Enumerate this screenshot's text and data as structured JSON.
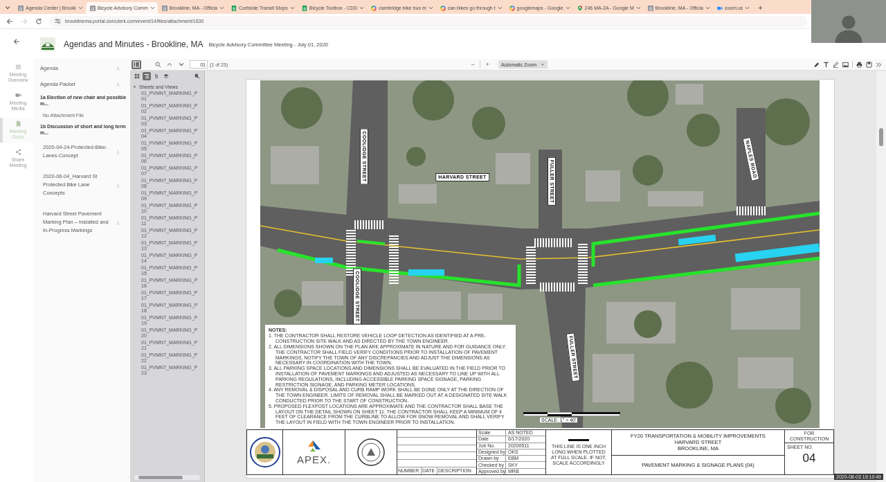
{
  "browser": {
    "tabs": [
      {
        "title": "Agenda Center | Brookl",
        "kind": "site",
        "selected": false
      },
      {
        "title": "Bicycle Advisory Comm",
        "kind": "site",
        "selected": true
      },
      {
        "title": "Brookline, MA - Officia",
        "kind": "site",
        "selected": false
      },
      {
        "title": "Curbside Transit Stops",
        "kind": "sheet",
        "selected": false
      },
      {
        "title": "Bicycle Toolbox - CDD",
        "kind": "sheet",
        "selected": false
      },
      {
        "title": "cambridge bike bus m",
        "kind": "google",
        "selected": false
      },
      {
        "title": "can bikes go through t",
        "kind": "google",
        "selected": false
      },
      {
        "title": "googlemaps - Google",
        "kind": "google",
        "selected": false
      },
      {
        "title": "246 MA-2A - Google M",
        "kind": "maps",
        "selected": false
      },
      {
        "title": "Brookline, MA - Officia",
        "kind": "site",
        "selected": false
      },
      {
        "title": "zoom.us",
        "kind": "zoom",
        "selected": false
      }
    ],
    "new_tab": "+",
    "can_go_forward": false,
    "url": "brooklinema.portal.civicclerk.com/event/14/files/attachment/1630"
  },
  "header": {
    "title": "Agendas and Minutes - Brookline, MA",
    "meeting": "Bicycle Advisory Committee Meeting - July 01, 2020"
  },
  "nav": [
    {
      "label": "Meeting Overview",
      "kind": "list",
      "selected": false
    },
    {
      "label": "Meeting Media",
      "kind": "video",
      "selected": false
    },
    {
      "label": "Meeting Docs",
      "kind": "doc",
      "selected": true
    },
    {
      "label": "Share Meeting",
      "kind": "share",
      "selected": false
    }
  ],
  "agenda": [
    {
      "kind": "file",
      "label": "Agenda"
    },
    {
      "kind": "file",
      "label": "Agenda Packet"
    },
    {
      "kind": "item",
      "label": "1a Election of new chair and possible m..."
    },
    {
      "kind": "empty",
      "label": "No Attachment File"
    },
    {
      "kind": "item",
      "label": "1b Discussion of short and long term m..."
    },
    {
      "kind": "attachment",
      "label": "2020-04-24-Protected-Bike-Lanes-Concept"
    },
    {
      "kind": "attachment",
      "label": "2020-06-04_Harvard St Protected Bike Lane Concepts"
    },
    {
      "kind": "attachment",
      "label": "Harvard Street Pavement Marking Plan – Installed and In-Progress Markings"
    }
  ],
  "viewer": {
    "toolbar": {
      "sidebar_open": true,
      "page": "01",
      "page_count": "(1 of 23)",
      "zoom_out": "−",
      "zoom_in": "+",
      "zoom": "Automatic Zoom"
    },
    "sidebar": {
      "views": [
        {
          "kind": "thumbnails",
          "selected": false
        },
        {
          "kind": "outline",
          "selected": true
        },
        {
          "kind": "attachments",
          "selected": false
        },
        {
          "kind": "layers",
          "selected": false
        },
        {
          "kind": "find",
          "selected": false
        }
      ],
      "tree": [
        {
          "label": "Sheets and Views",
          "expanded": true,
          "children": [
            {
              "label": "01_PVMNT_MARKING_P",
              "sheet": "01"
            },
            {
              "label": "01_PVMNT_MARKING_P",
              "sheet": "02"
            },
            {
              "label": "01_PVMNT_MARKING_P",
              "sheet": "03"
            },
            {
              "label": "01_PVMNT_MARKING_P",
              "sheet": "04"
            },
            {
              "label": "01_PVMNT_MARKING_P",
              "sheet": "05"
            },
            {
              "label": "01_PVMNT_MARKING_P",
              "sheet": "06"
            },
            {
              "label": "01_PVMNT_MARKING_P",
              "sheet": "07"
            },
            {
              "label": "01_PVMNT_MARKING_P",
              "sheet": "08"
            },
            {
              "label": "01_PVMNT_MARKING_P",
              "sheet": "09"
            },
            {
              "label": "01_PVMNT_MARKING_P",
              "sheet": "10"
            },
            {
              "label": "01_PVMNT_MARKING_P",
              "sheet": "11"
            },
            {
              "label": "01_PVMNT_MARKING_P",
              "sheet": "12"
            },
            {
              "label": "01_PVMNT_MARKING_P",
              "sheet": "13"
            },
            {
              "label": "01_PVMNT_MARKING_P",
              "sheet": "14"
            },
            {
              "label": "01_PVMNT_MARKING_P",
              "sheet": "15"
            },
            {
              "label": "01_PVMNT_MARKING_P",
              "sheet": "16"
            },
            {
              "label": "01_PVMNT_MARKING_P",
              "sheet": "17"
            },
            {
              "label": "01_PVMNT_MARKING_P",
              "sheet": "18"
            },
            {
              "label": "01_PVMNT_MARKING_P",
              "sheet": "19"
            },
            {
              "label": "01_PVMNT_MARKING_P",
              "sheet": "20"
            },
            {
              "label": "01_PVMNT_MARKING_P",
              "sheet": "21"
            },
            {
              "label": "01_PVMNT_MARKING_P",
              "sheet": "22"
            },
            {
              "label": "01_PVMNT_MARKING_P",
              "sheet": "23"
            }
          ]
        }
      ]
    },
    "sheet": {
      "streets": [
        "COOLIDGE STREET",
        "HARVARD STREET",
        "FULLER STREET",
        "NAPLES ROAD",
        "COOLIDGE STREET",
        "FULLER STREET"
      ],
      "notes_title": "NOTES:",
      "notes": [
        "1. THE CONTRACTOR SHALL RESTORE VEHICLE LOOP DETECTION AS IDENTIFIED AT A PRE-CONSTRUCTION SITE WALK AND AS DIRECTED BY THE TOWN ENGINEER.",
        "2. ALL DIMENSIONS SHOWN ON THE PLAN ARE APPROXIMATE IN NATURE AND FOR GUIDANCE ONLY. THE CONTRACTOR SHALL FIELD VERIFY CONDITIONS PRIOR TO INSTALLATION OF PAVEMENT MARKINGS, NOTIFY THE TOWN OF ANY DISCREPANCIES AND ADJUST THE DIMENSIONS AS NECESSARY IN COORDINATION WITH THE TOWN.",
        "3. ALL PARKING SPACE LOCATIONS AND DIMENSIONS SHALL BE EVALUATED IN THE FIELD PRIOR TO INSTALLATION OF PAVEMENT MARKINGS AND ADJUSTED AS NECESSARY TO LINE UP WITH ALL PARKING REGULATIONS, INCLUDING ACCESSIBLE PARKING SPACE SIGNAGE, PARKING RESTRICTION SIGNAGE, AND PARKING METER LOCATIONS.",
        "4. ANY REMOVAL & DISPOSAL AND CURB RAMP WORK SHALL BE DONE ONLY AT THE DIRECTION OF THE TOWN ENGINEER. LIMITS OF REMOVAL SHALL BE MARKED OUT AT A DESIGNATED SITE WALK CONDUCTED PRIOR TO THE START OF CONSTRUCTION.",
        "5. PROPOSED FLEXPOST LOCATIONS ARE APPROXIMATE AND THE CONTRACTOR SHALL BASE THE LAYOUT ON THE DETAIL SHOWN ON SHEET 11. THE CONTRACTOR SHALL KEEP A MINIMUM OF 4 FEET OF CLEARANCE FROM THE CURBLINE TO ALLOW FOR SNOW REMOVAL AND SHALL VERIFY THE LAYOUT IN FIELD WITH THE TOWN ENGINEER PRIOR TO INSTALLATION."
      ],
      "scale": "SCALE: 1\" = 40'",
      "title_block": {
        "logo": "APEX.",
        "revisions_header": [
          "NUMBER",
          "DATE",
          "DESCRIPTION"
        ],
        "info": [
          {
            "label": "Scale",
            "value": "AS NOTED"
          },
          {
            "label": "Date",
            "value": "6/17/2020"
          },
          {
            "label": "Job No.",
            "value": "20200511"
          },
          {
            "label": "Designed by",
            "value": "OKS"
          },
          {
            "label": "Drawn by",
            "value": "EBM"
          },
          {
            "label": "Checked by",
            "value": "SKY"
          },
          {
            "label": "Approved by",
            "value": "MRB"
          }
        ],
        "plot_note": "THIS LINE IS ONE INCH LONG WHEN PLOTTED AT FULL SCALE. IF NOT, SCALE ACCORDINGLY",
        "project": "FY20 TRANSPORTATION & MOBILITY IMPROVEMENTS",
        "street": "HARVARD STREET",
        "town": "BROOKLINE, MA",
        "sheet_title": "PAVEMENT MARKING & SIGNAGE PLANS (04)",
        "status": "FOR CONSTRUCTION",
        "sheet_label": "SHEET NO.",
        "sheet_no": "04"
      }
    }
  },
  "timestamp": "2020-08-03 19:10:49"
}
